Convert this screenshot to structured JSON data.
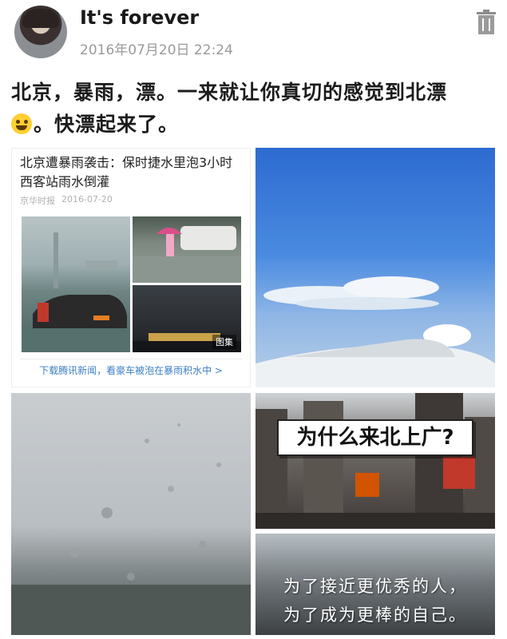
{
  "post": {
    "username": "It's forever",
    "timestamp": "2016年07月20日  22:24",
    "text_line1": "北京，暴雨，漂。一来就让你真切的感觉到北漂",
    "text_line2": "。快漂起来了。",
    "emoji": "face-with-tears-of-joy"
  },
  "news_card": {
    "title": "北京遭暴雨袭击：保时捷水里泡3小时 西客站雨水倒灌",
    "source": "京华时报",
    "date": "2016-07-20",
    "gallery_label": "图集",
    "link_text": "下载腾讯新闻，看豪车被泡在暴雨积水中 >"
  },
  "city_image": {
    "caption": "为什么来北上广?"
  },
  "quote_image": {
    "line1": "为了接近更优秀的人，",
    "line2": "为了成为更棒的自己。"
  },
  "colors": {
    "link_blue": "#3b7fc4",
    "timestamp_gray": "#9a9a9a"
  }
}
